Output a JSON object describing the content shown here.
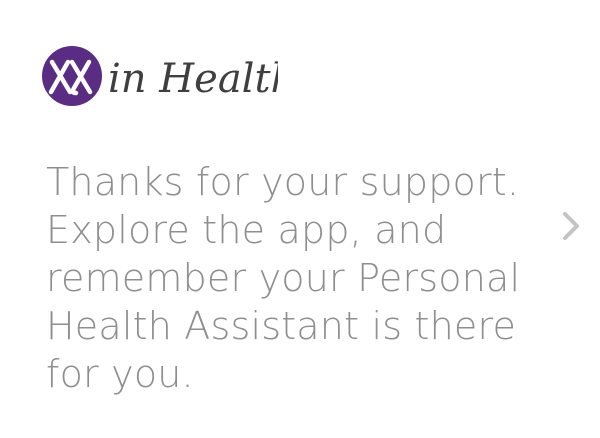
{
  "app": {
    "logo_text": "in Health",
    "logo_badge": "XX",
    "brand_color": "#5b2c83"
  },
  "message": {
    "lines": [
      "Thanks for your support.",
      "Explore the app, and",
      "remember your Personal",
      "Health Assistant is there",
      "for you."
    ],
    "text_color": "#8e8e8e"
  },
  "navigation": {
    "next_icon": "chevron-right-icon",
    "next_color": "#c4c4c4"
  }
}
